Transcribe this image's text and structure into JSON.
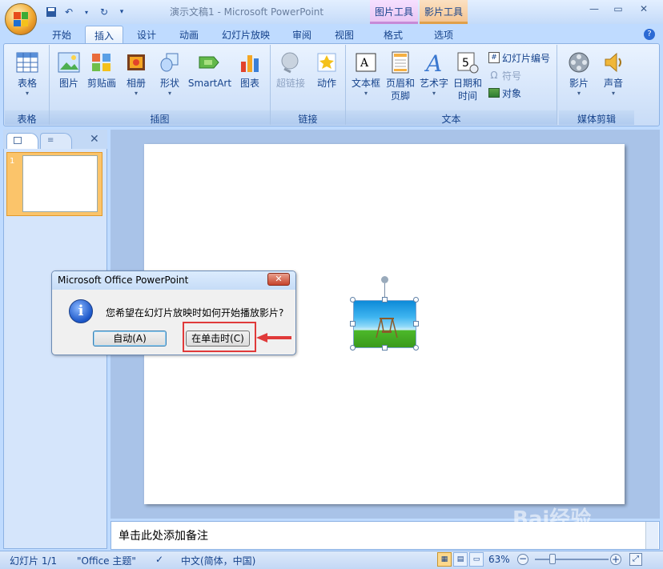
{
  "app": {
    "doc_title": "演示文稿1 - Microsoft PowerPoint",
    "context_tabs": [
      "图片工具",
      "影片工具"
    ]
  },
  "tabs": [
    "开始",
    "插入",
    "设计",
    "动画",
    "幻灯片放映",
    "审阅",
    "视图",
    "格式",
    "选项"
  ],
  "active_tab": "插入",
  "ribbon": {
    "groups": {
      "table": {
        "label": "表格",
        "buttons": [
          "表格"
        ]
      },
      "illustrations": {
        "label": "插图",
        "buttons": [
          "图片",
          "剪贴画",
          "相册",
          "形状",
          "SmartArt",
          "图表"
        ]
      },
      "links": {
        "label": "链接",
        "buttons": [
          "超链接",
          "动作"
        ]
      },
      "text": {
        "label": "文本",
        "buttons": [
          "文本框",
          "页眉和页脚",
          "艺术字",
          "日期和时间"
        ],
        "small": [
          "幻灯片编号",
          "符号",
          "对象"
        ]
      },
      "media": {
        "label": "媒体剪辑",
        "buttons": [
          "影片",
          "声音"
        ]
      }
    }
  },
  "slides_panel": {
    "slide_number": "1"
  },
  "notes": {
    "placeholder": "单击此处添加备注"
  },
  "status": {
    "slide": "幻灯片 1/1",
    "theme": "\"Office 主题\"",
    "language": "中文(简体，中国)",
    "zoom": "63%"
  },
  "dialog": {
    "title": "Microsoft Office PowerPoint",
    "message": "您希望在幻灯片放映时如何开始播放影片?",
    "btn_auto": "自动(A)",
    "btn_click": "在单击时(C)"
  },
  "watermark": "Bai经验",
  "colors": {
    "accent": "#15428b",
    "highlight": "#e03a3a"
  }
}
